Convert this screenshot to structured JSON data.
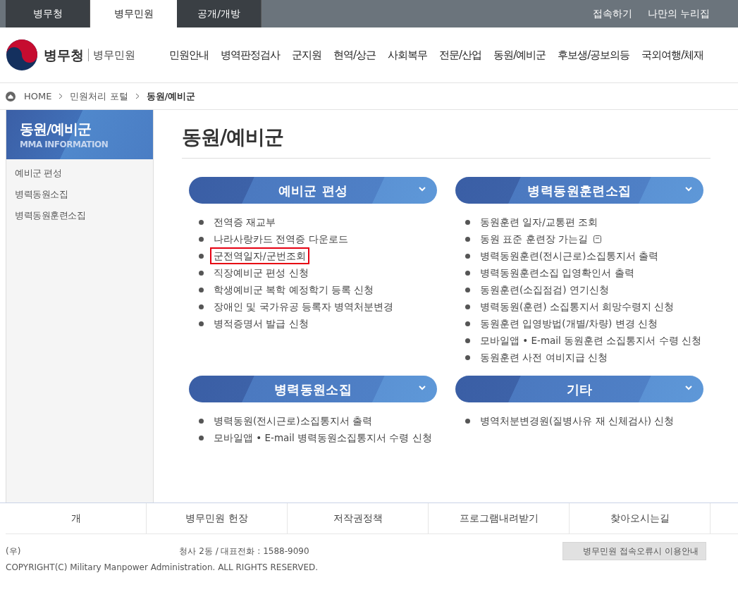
{
  "top_bar": {
    "tabs": [
      {
        "label": "병무청",
        "selected": false
      },
      {
        "label": "병무민원",
        "selected": true
      },
      {
        "label": "공개/개방",
        "selected": false
      }
    ],
    "links": [
      "접속하기",
      "나만의 누리집"
    ]
  },
  "header": {
    "logo_text": "병무청",
    "logo_sub": "병무민원",
    "nav": [
      "민원안내",
      "병역판정검사",
      "군지원",
      "현역/상근",
      "사회복무",
      "전문/산업",
      "동원/예비군",
      "후보생/공보의등",
      "국외여행/체재"
    ]
  },
  "breadcrumb": [
    "HOME",
    "민원처리 포털",
    "동원/예비군"
  ],
  "sidebar": {
    "title": "동원/예비군",
    "subtitle": "MMA INFORMATION",
    "items": [
      "예비군 편성",
      "병력동원소집",
      "병력동원훈련소집"
    ]
  },
  "page_title": "동원/예비군",
  "sections": [
    {
      "title": "예비군 편성",
      "items": [
        {
          "label": "전역증 재교부",
          "highlighted": false,
          "new_window": false
        },
        {
          "label": "나라사랑카드 전역증 다운로드",
          "highlighted": false,
          "new_window": false
        },
        {
          "label": "군전역일자/군번조회",
          "highlighted": true,
          "new_window": false
        },
        {
          "label": "직장예비군 편성 신청",
          "highlighted": false,
          "new_window": false
        },
        {
          "label": "학생예비군 복학 예정학기 등록 신청",
          "highlighted": false,
          "new_window": false
        },
        {
          "label": "장애인 및 국가유공 등록자 병역처분변경",
          "highlighted": false,
          "new_window": false
        },
        {
          "label": "병적증명서 발급 신청",
          "highlighted": false,
          "new_window": false
        }
      ]
    },
    {
      "title": "병력동원훈련소집",
      "items": [
        {
          "label": "동원훈련 일자/교통편 조회",
          "highlighted": false,
          "new_window": false
        },
        {
          "label": "동원 표준 훈련장 가는길",
          "highlighted": false,
          "new_window": true
        },
        {
          "label": "병력동원훈련(전시근로)소집통지서 출력",
          "highlighted": false,
          "new_window": false
        },
        {
          "label": "병력동원훈련소집 입영확인서 출력",
          "highlighted": false,
          "new_window": false
        },
        {
          "label": "동원훈련(소집점검) 연기신청",
          "highlighted": false,
          "new_window": false
        },
        {
          "label": "병력동원(훈련) 소집통지서 희망수령지 신청",
          "highlighted": false,
          "new_window": false
        },
        {
          "label": "동원훈련 입영방법(개별/차량) 변경 신청",
          "highlighted": false,
          "new_window": false
        },
        {
          "label": "모바일앱 • E-mail 동원훈련 소집통지서 수령 신청",
          "highlighted": false,
          "new_window": false
        },
        {
          "label": "동원훈련 사전 여비지급 신청",
          "highlighted": false,
          "new_window": false
        }
      ]
    },
    {
      "title": "병력동원소집",
      "items": [
        {
          "label": "병력동원(전시근로)소집통지서 출력",
          "highlighted": false,
          "new_window": false
        },
        {
          "label": "모바일앱 • E-mail 병력동원소집통지서 수령 신청",
          "highlighted": false,
          "new_window": false
        }
      ]
    },
    {
      "title": "기타",
      "items": [
        {
          "label": "병역처분변경원(질병사유 재 신체검사) 신청",
          "highlighted": false,
          "new_window": false
        }
      ]
    }
  ],
  "footer": {
    "links": [
      "개",
      "병무민원 헌장",
      "저작권정책",
      "프로그램내려받기",
      "찾아오시는길"
    ],
    "address_start": "(우)",
    "address_end": "청사 2동 / 대표전화 : 1588-9090",
    "copyright": "COPYRIGHT(C) Military Manpower Administration. ALL RIGHTS RESERVED.",
    "help_button": "병무민원 접속오류시 이용안내"
  }
}
